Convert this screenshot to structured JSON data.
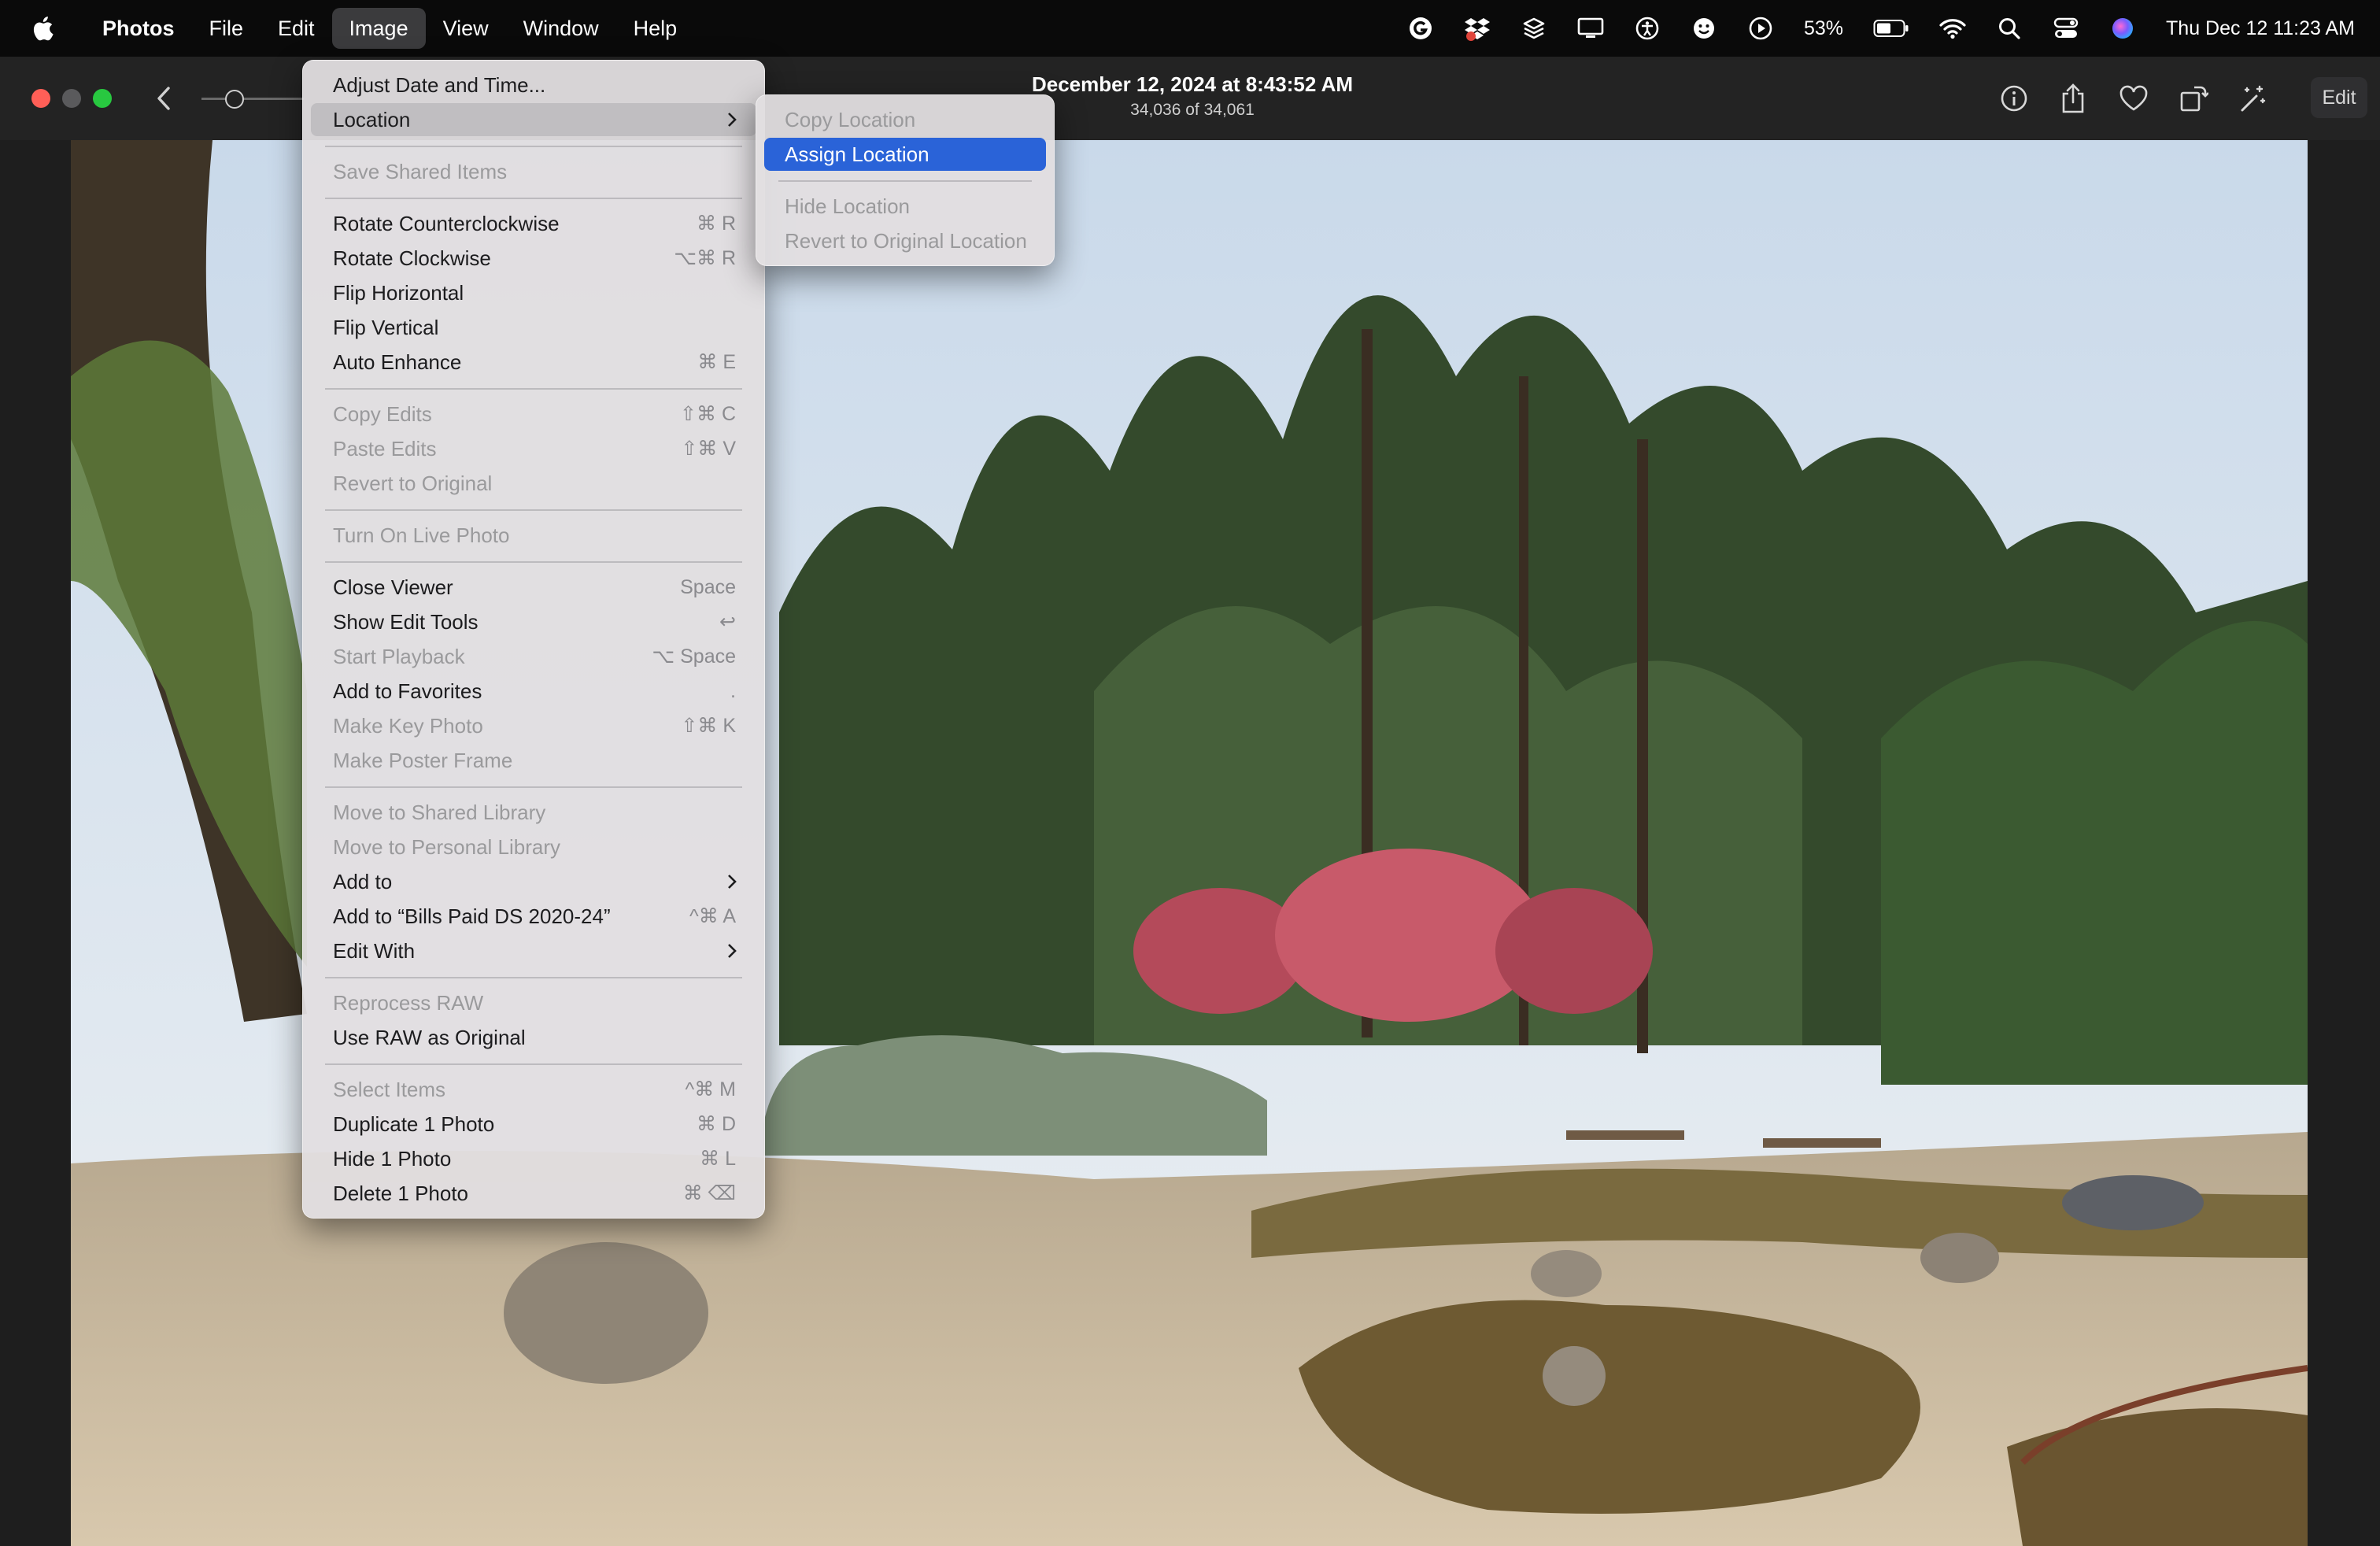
{
  "menubar": {
    "app_name": "Photos",
    "menus": [
      "File",
      "Edit",
      "Image",
      "View",
      "Window",
      "Help"
    ],
    "open_menu": "Image",
    "status": {
      "battery_percent": "53%",
      "datetime": "Thu Dec 12  11:23 AM",
      "icons": [
        "grammarly-icon",
        "dropbox-icon",
        "layers-icon",
        "display-icon",
        "accessibility-icon",
        "face-icon",
        "play-icon",
        "battery-icon",
        "wifi-icon",
        "search-icon",
        "control-center-icon",
        "siri-icon"
      ]
    }
  },
  "toolbar": {
    "title": "December 12, 2024 at 8:43:52 AM",
    "count": "34,036 of 34,061",
    "edit_label": "Edit",
    "icons": [
      "info-icon",
      "share-icon",
      "heart-icon",
      "rotate-icon",
      "enhance-icon"
    ]
  },
  "image_menu": {
    "items": [
      {
        "label": "Adjust Date and Time...",
        "shortcut": "",
        "enabled": true
      },
      {
        "label": "Location",
        "shortcut": "",
        "enabled": true,
        "submenu": true,
        "highlighted": true
      },
      {
        "label": "Save Shared Items",
        "shortcut": "",
        "enabled": false
      },
      {
        "label": "Rotate Counterclockwise",
        "shortcut": "⌘ R",
        "enabled": true
      },
      {
        "label": "Rotate Clockwise",
        "shortcut": "⌥⌘ R",
        "enabled": true
      },
      {
        "label": "Flip Horizontal",
        "shortcut": "",
        "enabled": true
      },
      {
        "label": "Flip Vertical",
        "shortcut": "",
        "enabled": true
      },
      {
        "label": "Auto Enhance",
        "shortcut": "⌘ E",
        "enabled": true
      },
      {
        "label": "Copy Edits",
        "shortcut": "⇧⌘ C",
        "enabled": false
      },
      {
        "label": "Paste Edits",
        "shortcut": "⇧⌘ V",
        "enabled": false
      },
      {
        "label": "Revert to Original",
        "shortcut": "",
        "enabled": false
      },
      {
        "label": "Turn On Live Photo",
        "shortcut": "",
        "enabled": false
      },
      {
        "label": "Close Viewer",
        "shortcut": "Space",
        "enabled": true
      },
      {
        "label": "Show Edit Tools",
        "shortcut": "↩",
        "enabled": true
      },
      {
        "label": "Start Playback",
        "shortcut": "⌥ Space",
        "enabled": false
      },
      {
        "label": "Add to Favorites",
        "shortcut": ".",
        "enabled": true
      },
      {
        "label": "Make Key Photo",
        "shortcut": "⇧⌘ K",
        "enabled": false
      },
      {
        "label": "Make Poster Frame",
        "shortcut": "",
        "enabled": false
      },
      {
        "label": "Move to Shared Library",
        "shortcut": "",
        "enabled": false
      },
      {
        "label": "Move to Personal Library",
        "shortcut": "",
        "enabled": false
      },
      {
        "label": "Add to",
        "shortcut": "",
        "enabled": true,
        "submenu": true
      },
      {
        "label": "Add to “Bills Paid DS 2020-24”",
        "shortcut": "^⌘ A",
        "enabled": true
      },
      {
        "label": "Edit With",
        "shortcut": "",
        "enabled": true,
        "submenu": true
      },
      {
        "label": "Reprocess RAW",
        "shortcut": "",
        "enabled": false
      },
      {
        "label": "Use RAW as Original",
        "shortcut": "",
        "enabled": true
      },
      {
        "label": "Select Items",
        "shortcut": "^⌘ M",
        "enabled": false
      },
      {
        "label": "Duplicate 1 Photo",
        "shortcut": "⌘ D",
        "enabled": true
      },
      {
        "label": "Hide 1 Photo",
        "shortcut": "⌘ L",
        "enabled": true
      },
      {
        "label": "Delete 1 Photo",
        "shortcut": "⌘ ⌫",
        "enabled": true
      }
    ]
  },
  "location_submenu": {
    "items": [
      {
        "label": "Copy Location",
        "enabled": false
      },
      {
        "label": "Assign Location",
        "enabled": true,
        "selected": true
      },
      {
        "label": "Hide Location",
        "enabled": false
      },
      {
        "label": "Revert to Original Location",
        "enabled": false
      }
    ]
  },
  "colors": {
    "menu_highlight": "#2a63d8",
    "traffic_red": "#ff5f57",
    "traffic_gray": "#5a5a5c",
    "traffic_green": "#28c840"
  }
}
